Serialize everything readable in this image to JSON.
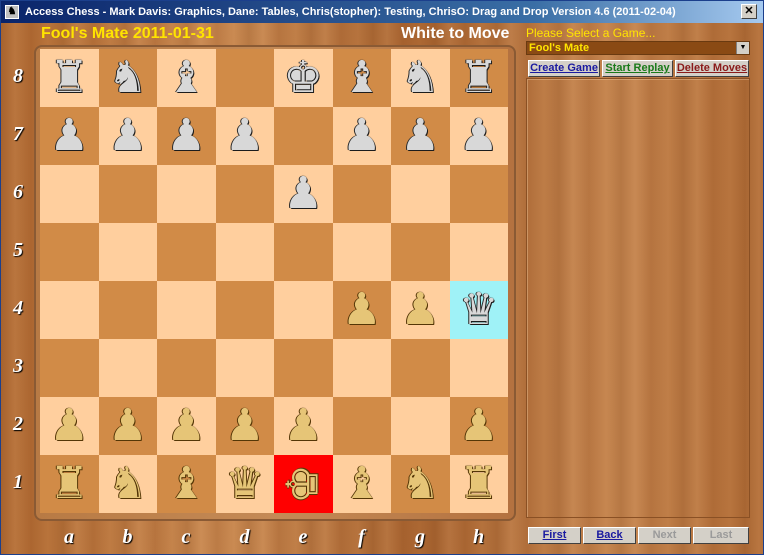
{
  "window": {
    "title": "Access Chess  - Mark Davis: Graphics,  Dane: Tables,  Chris(stopher): Testing,  ChrisO: Drag and Drop  Version 4.6 (2011-02-04)",
    "close_glyph": "✕"
  },
  "header": {
    "game_title": "Fool's Mate  2011-01-31",
    "turn": "White to Move"
  },
  "board": {
    "ranks": [
      "8",
      "7",
      "6",
      "5",
      "4",
      "3",
      "2",
      "1"
    ],
    "files": [
      "a",
      "b",
      "c",
      "d",
      "e",
      "f",
      "g",
      "h"
    ],
    "rows": [
      [
        {
          "piece": "♜",
          "color": "black"
        },
        {
          "piece": "♞",
          "color": "black"
        },
        {
          "piece": "♝",
          "color": "black"
        },
        {
          "piece": "",
          "color": ""
        },
        {
          "piece": "♚",
          "color": "black"
        },
        {
          "piece": "♝",
          "color": "black"
        },
        {
          "piece": "♞",
          "color": "black"
        },
        {
          "piece": "♜",
          "color": "black"
        }
      ],
      [
        {
          "piece": "♟",
          "color": "black"
        },
        {
          "piece": "♟",
          "color": "black"
        },
        {
          "piece": "♟",
          "color": "black"
        },
        {
          "piece": "♟",
          "color": "black"
        },
        {
          "piece": "",
          "color": ""
        },
        {
          "piece": "♟",
          "color": "black"
        },
        {
          "piece": "♟",
          "color": "black"
        },
        {
          "piece": "♟",
          "color": "black"
        }
      ],
      [
        {
          "piece": "",
          "color": ""
        },
        {
          "piece": "",
          "color": ""
        },
        {
          "piece": "",
          "color": ""
        },
        {
          "piece": "",
          "color": ""
        },
        {
          "piece": "♟",
          "color": "black"
        },
        {
          "piece": "",
          "color": ""
        },
        {
          "piece": "",
          "color": ""
        },
        {
          "piece": "",
          "color": ""
        }
      ],
      [
        {
          "piece": "",
          "color": ""
        },
        {
          "piece": "",
          "color": ""
        },
        {
          "piece": "",
          "color": ""
        },
        {
          "piece": "",
          "color": ""
        },
        {
          "piece": "",
          "color": ""
        },
        {
          "piece": "",
          "color": ""
        },
        {
          "piece": "",
          "color": ""
        },
        {
          "piece": "",
          "color": ""
        }
      ],
      [
        {
          "piece": "",
          "color": ""
        },
        {
          "piece": "",
          "color": ""
        },
        {
          "piece": "",
          "color": ""
        },
        {
          "piece": "",
          "color": ""
        },
        {
          "piece": "",
          "color": ""
        },
        {
          "piece": "♟",
          "color": "white"
        },
        {
          "piece": "♟",
          "color": "white"
        },
        {
          "piece": "♛",
          "color": "black",
          "highlight": "cyan"
        }
      ],
      [
        {
          "piece": "",
          "color": ""
        },
        {
          "piece": "",
          "color": ""
        },
        {
          "piece": "",
          "color": ""
        },
        {
          "piece": "",
          "color": ""
        },
        {
          "piece": "",
          "color": ""
        },
        {
          "piece": "",
          "color": ""
        },
        {
          "piece": "",
          "color": ""
        },
        {
          "piece": "",
          "color": ""
        }
      ],
      [
        {
          "piece": "♟",
          "color": "white"
        },
        {
          "piece": "♟",
          "color": "white"
        },
        {
          "piece": "♟",
          "color": "white"
        },
        {
          "piece": "♟",
          "color": "white"
        },
        {
          "piece": "♟",
          "color": "white"
        },
        {
          "piece": "",
          "color": ""
        },
        {
          "piece": "",
          "color": ""
        },
        {
          "piece": "♟",
          "color": "white"
        }
      ],
      [
        {
          "piece": "♜",
          "color": "white"
        },
        {
          "piece": "♞",
          "color": "white"
        },
        {
          "piece": "♝",
          "color": "white"
        },
        {
          "piece": "♛",
          "color": "white"
        },
        {
          "piece": "♚",
          "color": "white",
          "highlight": "red",
          "fallen": true
        },
        {
          "piece": "♝",
          "color": "white"
        },
        {
          "piece": "♞",
          "color": "white"
        },
        {
          "piece": "♜",
          "color": "white"
        }
      ]
    ],
    "colors": {
      "light": "#ffcf9e",
      "dark": "#d18b47",
      "check": "#ff0000",
      "last_move": "#9ff2f7"
    }
  },
  "side_panel": {
    "select_label": "Please Select a Game...",
    "selected_game": "Fool's Mate",
    "buttons": {
      "create": {
        "label": "Create Game",
        "color": "#1a1aa0"
      },
      "replay": {
        "label": "Start Replay",
        "color": "#1a7a1a"
      },
      "delete": {
        "label": "Delete Moves",
        "color": "#8a1a1a"
      }
    }
  },
  "navigation": {
    "first": "First",
    "back": "Back",
    "next": "Next",
    "last": "Last"
  }
}
